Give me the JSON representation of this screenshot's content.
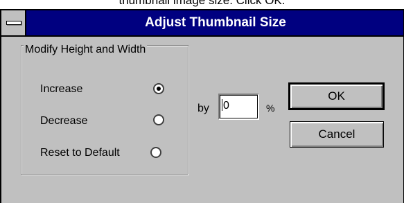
{
  "caption": "thumbnail image size. Click OK.",
  "window": {
    "title": "Adjust Thumbnail Size"
  },
  "group": {
    "label": "Modify Height and Width",
    "options": [
      {
        "label": "Increase",
        "selected": true
      },
      {
        "label": "Decrease",
        "selected": false
      },
      {
        "label": "Reset to Default",
        "selected": false
      }
    ]
  },
  "percent": {
    "by_label": "by",
    "value": "0",
    "unit": "%"
  },
  "buttons": {
    "ok": "OK",
    "cancel": "Cancel"
  },
  "colors": {
    "titlebar": "#000080",
    "dialog_bg": "#c0c0c0"
  }
}
